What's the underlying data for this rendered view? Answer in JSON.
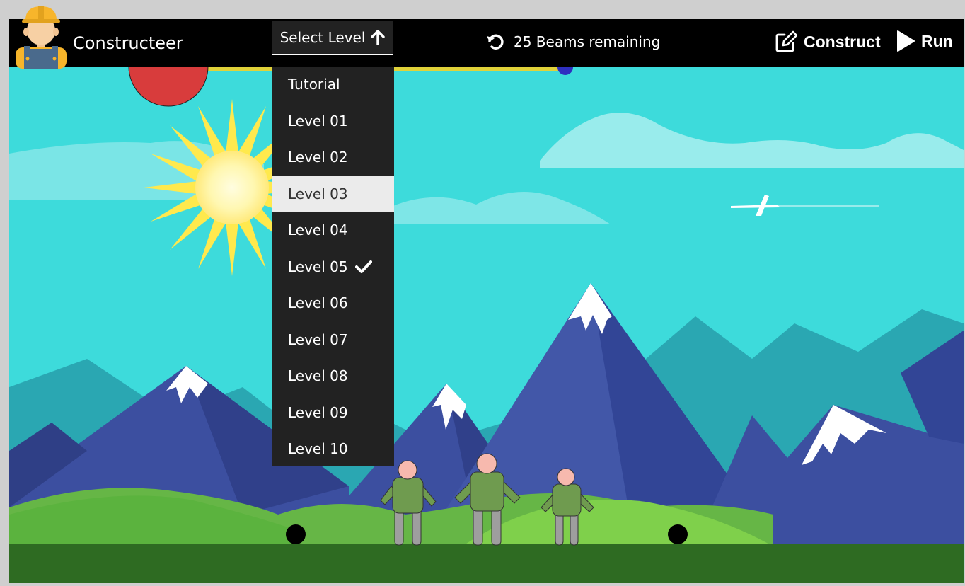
{
  "app": {
    "title": "Constructeer"
  },
  "toolbar": {
    "select_level_label": "Select Level",
    "beams_remaining_text": "25 Beams remaining",
    "construct_label": "Construct",
    "run_label": "Run"
  },
  "level_menu": {
    "items": [
      {
        "label": "Tutorial"
      },
      {
        "label": "Level 01"
      },
      {
        "label": "Level 02"
      },
      {
        "label": "Level 03",
        "hover": true
      },
      {
        "label": "Level 04"
      },
      {
        "label": "Level 05",
        "completed": true
      },
      {
        "label": "Level 06"
      },
      {
        "label": "Level 07"
      },
      {
        "label": "Level 08"
      },
      {
        "label": "Level 09"
      },
      {
        "label": "Level 10"
      }
    ]
  },
  "icons": {
    "avatar": "constructor-avatar-icon",
    "select_arrow": "arrow-up-icon",
    "reset": "undo-icon",
    "construct": "edit-icon",
    "run": "play-icon",
    "completed": "checkmark-icon"
  },
  "colors": {
    "sky": "#3ddbdb",
    "bar": "#000000",
    "menu": "#222222",
    "menu_hover": "#ebebeb",
    "ball": "#d83c3c",
    "beam": "#e0d23a",
    "ground": "#2e6b22"
  }
}
